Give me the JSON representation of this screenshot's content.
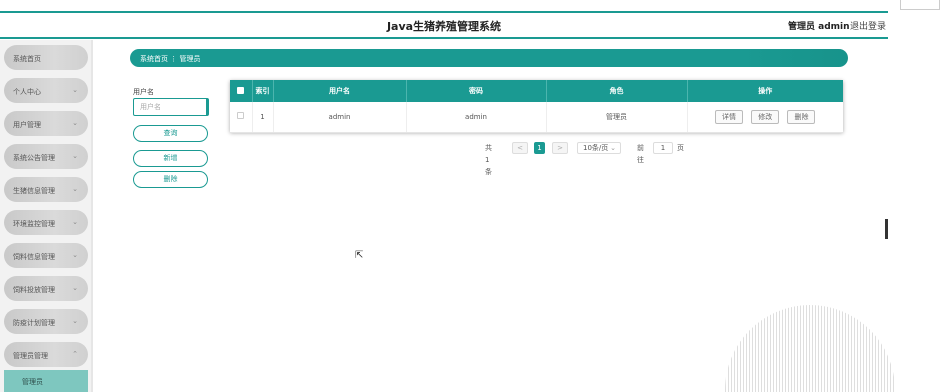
{
  "header": {
    "title": "Java生猪养殖管理系统",
    "user": "管理员 admin",
    "logout": "退出登录"
  },
  "sidebar": {
    "items": [
      {
        "label": "系统首页",
        "chevron": ""
      },
      {
        "label": "个人中心",
        "chevron": "⌄"
      },
      {
        "label": "用户管理",
        "chevron": "⌄"
      },
      {
        "label": "系统公告管理",
        "chevron": "⌄"
      },
      {
        "label": "生猪信息管理",
        "chevron": "⌄"
      },
      {
        "label": "环境监控管理",
        "chevron": "⌄"
      },
      {
        "label": "饲料信息管理",
        "chevron": "⌄"
      },
      {
        "label": "饲料投放管理",
        "chevron": "⌄"
      },
      {
        "label": "防疫计划管理",
        "chevron": "⌄"
      },
      {
        "label": "管理员管理",
        "chevron": "⌃"
      }
    ],
    "active_sub": "管理员"
  },
  "breadcrumb": {
    "text": "系统首页 ⋮ 管理员"
  },
  "search": {
    "label": "用户名",
    "placeholder": "用户名",
    "query_button": "查询",
    "add_button": "新增",
    "delete_button": "删除"
  },
  "table": {
    "columns": [
      "",
      "索引",
      "用户名",
      "密码",
      "角色",
      "操作"
    ],
    "rows": [
      {
        "index": "1",
        "username": "admin",
        "password": "admin",
        "role": "管理员"
      }
    ],
    "actions": {
      "detail": "详情",
      "edit": "修改",
      "delete": "删除"
    }
  },
  "pagination": {
    "total": "共 1 条",
    "prev": "<",
    "page": "1",
    "next": ">",
    "page_size": "10条/页",
    "goto_label": "前往",
    "goto_value": "1",
    "page_unit": "页"
  },
  "colors": {
    "accent": "#1a9a92",
    "sidebar_active": "#7ec7bf"
  }
}
